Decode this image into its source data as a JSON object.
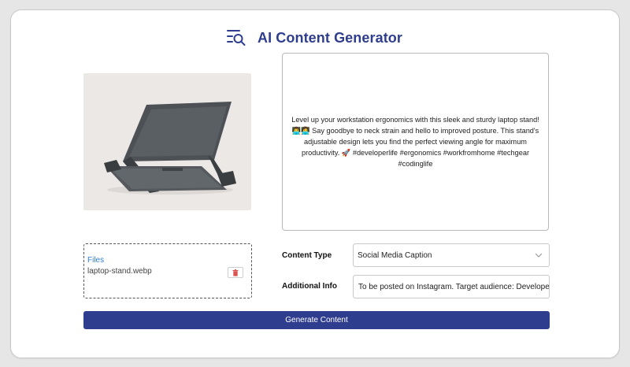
{
  "header": {
    "title": "AI Content Generator",
    "icon": "search-lines-icon"
  },
  "image": {
    "alt": "laptop stand product photo"
  },
  "output": {
    "text": "Level up your workstation ergonomics with this sleek and sturdy laptop stand! 👨‍💻👩‍💻 Say goodbye to neck strain and hello to improved posture. This stand's adjustable design lets you find the perfect viewing angle for maximum productivity. 🚀 #developerlife #ergonomics #workfromhome #techgear #codinglife"
  },
  "files": {
    "label": "Files",
    "file_name": "laptop-stand.webp",
    "delete_icon": "trash-icon"
  },
  "form": {
    "content_type_label": "Content Type",
    "content_type_value": "Social Media Caption",
    "additional_info_label": "Additional Info",
    "additional_info_value": "To be posted on Instagram. Target audience: Developers."
  },
  "actions": {
    "generate_label": "Generate Content"
  },
  "colors": {
    "brand": "#2f3d8e",
    "link": "#2f7fcf",
    "delete": "#d9534f"
  }
}
